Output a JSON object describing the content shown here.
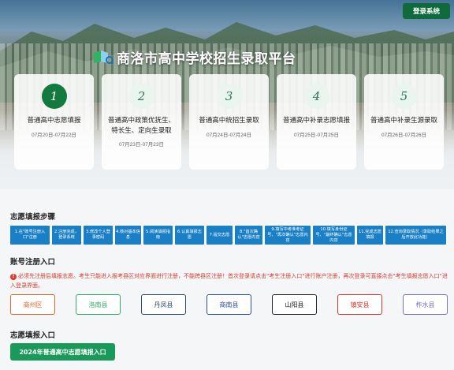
{
  "header": {
    "login_label": "登录系统",
    "title": "商洛市高中学校招生录取平台",
    "logo_icon": "school-logo-icon"
  },
  "stages": [
    {
      "num": "1",
      "name": "普通高中志愿填报",
      "date": "07月20日-07月22日",
      "active": true
    },
    {
      "num": "2",
      "name": "普通高中政策优抚生、特长生、定向生录取",
      "date": "07月23日-07月23日",
      "active": false
    },
    {
      "num": "3",
      "name": "普通高中统招生录取",
      "date": "07月24日-07月24日",
      "active": false
    },
    {
      "num": "4",
      "name": "普通高中补录志愿填报",
      "date": "07月25日-07月25日",
      "active": false
    },
    {
      "num": "5",
      "name": "普通高中补录生源录取",
      "date": "07月26日-07月26日",
      "active": false
    }
  ],
  "steps_section": {
    "title": "志愿填报步骤",
    "steps": [
      "1.在\"账号注册入口\"注册",
      "2.注册完成，登录系统",
      "3.修改个人登录密码",
      "4.核对基本信息",
      "5.阅读填报指南",
      "6.认真填报志愿",
      "7.提交志愿",
      "8.\"首次确认\"志愿内容",
      "9.填写中考准考证号、\"再次确认\"志愿内容",
      "10.填写身份证号、\"最终确认\"志愿内容",
      "11.完成志愿填报",
      "12.查询录取情况（录取结果之后开放此功能）"
    ]
  },
  "register_section": {
    "title": "账号注册入口",
    "notice": "必须先注册后填报志愿。考生只能进入报考县区对应界面进行注册，不能跨县区注册！首次登录请点击\"考生注册入口\"进行账户注册，再次登录可直接点击\"考生填报志愿入口\"进入登录界面。",
    "notice_icon": "alert-icon",
    "counties": [
      {
        "name": "商州区",
        "color": "#e0652a"
      },
      {
        "name": "洛南县",
        "color": "#2fae6a"
      },
      {
        "name": "丹凤县",
        "color": "#2f4a6a"
      },
      {
        "name": "商南县",
        "color": "#2a4fae"
      },
      {
        "name": "山阳县",
        "color": "#222222"
      },
      {
        "name": "镇安县",
        "color": "#d9362b"
      },
      {
        "name": "柞水县",
        "color": "#7a6fd0"
      }
    ]
  },
  "entry_section": {
    "title": "志愿填报入口",
    "button_label": "2024年普通高中志愿填报入口"
  },
  "colors": {
    "brand_green": "#127a3f",
    "step_blue": "#1a7fc4",
    "notice_red": "#d93a2b",
    "entry_green": "#1a9a5a"
  }
}
